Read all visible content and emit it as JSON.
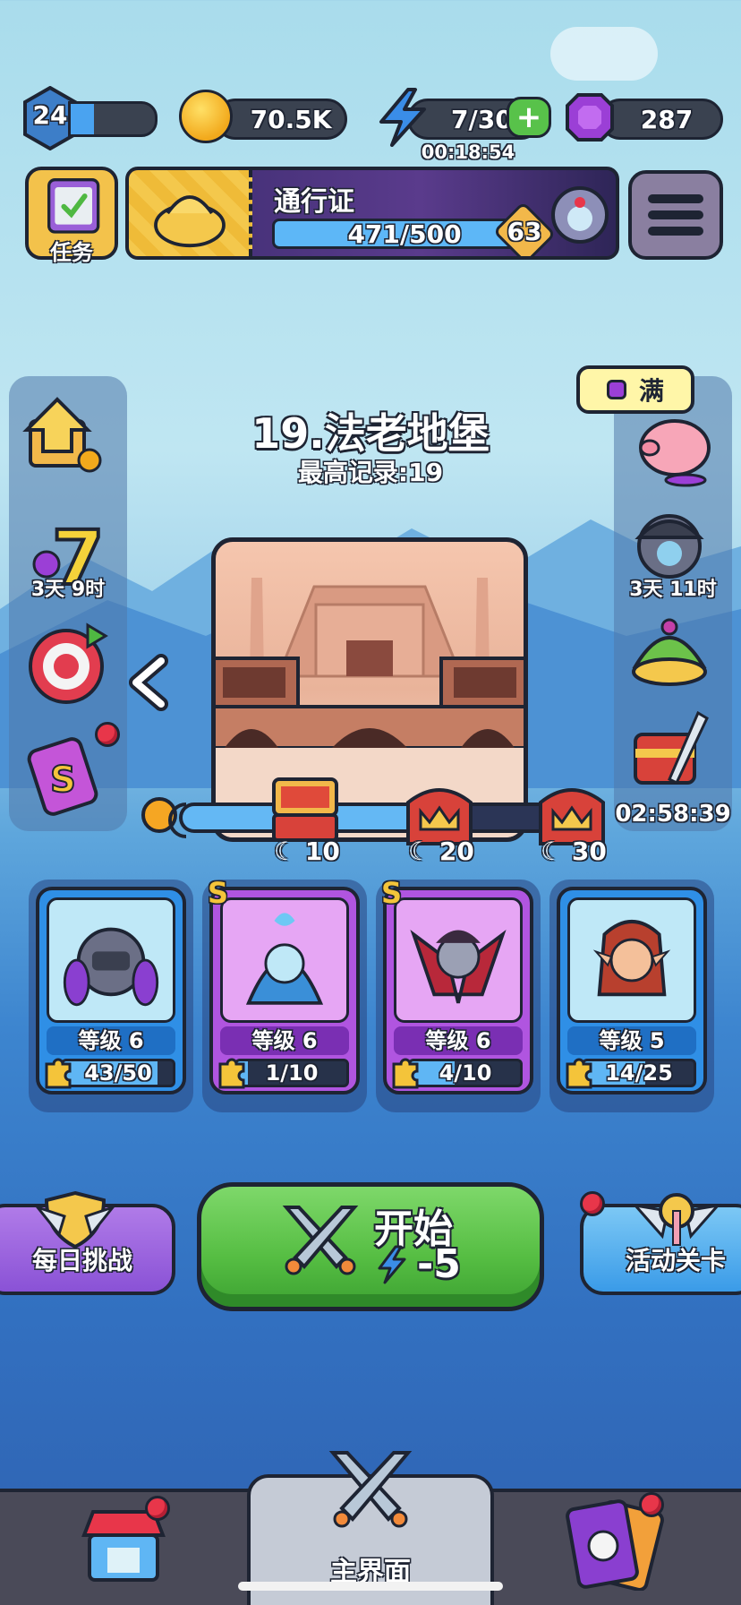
{
  "player": {
    "level": "24",
    "xp_fraction": 0.28
  },
  "currency": {
    "coins": "70.5K",
    "energy": "7/30",
    "energy_timer": "00:18:54",
    "gems": "287"
  },
  "header": {
    "tasks_label": "任务",
    "pass_title": "通行证",
    "pass_progress": "471/500",
    "pass_progress_fraction": 0.94,
    "pass_level": "63"
  },
  "left_sidebar": {
    "items": [
      {
        "name": "upgrade-gift-icon"
      },
      {
        "name": "seven-day-event-icon",
        "timer": "3天 9时"
      },
      {
        "name": "target-icon"
      },
      {
        "name": "s-card-icon",
        "has_badge": true
      }
    ]
  },
  "right_sidebar": {
    "piggy_label": "满",
    "items": [
      {
        "name": "piggy-bank-icon"
      },
      {
        "name": "pirate-event-icon",
        "timer": "3天 11时"
      },
      {
        "name": "cake-icon"
      },
      {
        "name": "treasure-sword-icon",
        "timer": "02:58:39"
      }
    ]
  },
  "stage": {
    "title": "19.法老地堡",
    "record": "最高记录:19",
    "progress_fraction": 0.62,
    "chests": [
      {
        "label": "10"
      },
      {
        "label": "20"
      },
      {
        "label": "30"
      }
    ]
  },
  "heroes": [
    {
      "grade": "",
      "level": "等级 6",
      "shards": "43/50",
      "fraction": 0.86,
      "color": "blue"
    },
    {
      "grade": "S",
      "level": "等级 6",
      "shards": "1/10",
      "fraction": 0.1,
      "color": "purple"
    },
    {
      "grade": "S",
      "level": "等级 6",
      "shards": "4/10",
      "fraction": 0.4,
      "color": "purple"
    },
    {
      "grade": "",
      "level": "等级 5",
      "shards": "14/25",
      "fraction": 0.56,
      "color": "blue"
    }
  ],
  "actions": {
    "daily_challenge": "每日挑战",
    "start": "开始",
    "start_cost": "-5",
    "event_stage": "活动关卡"
  },
  "nav": {
    "main_label": "主界面"
  },
  "colors": {
    "accent_green": "#55bd42",
    "energy_blue": "#3a8de8",
    "gem_purple": "#9b3fd6",
    "coin_gold": "#f2a91c"
  }
}
